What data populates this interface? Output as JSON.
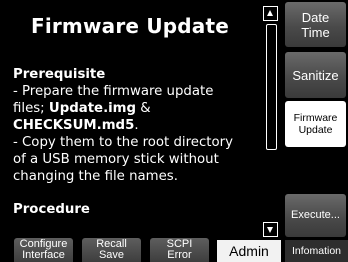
{
  "title": "Firmware Update",
  "content": {
    "prerequisite_heading": "Prerequisite",
    "line_1": "- Prepare the firmware update",
    "line_2_prefix": "files; ",
    "file_1": "Update.img",
    "line_2_suffix": " &",
    "file_2": "CHECKSUM.md5",
    "line_3_suffix": ".",
    "line_4": "- Copy them to the root directory",
    "line_5": "of a USB memory stick without",
    "line_6": "changing the file names.",
    "procedure_heading": "Procedure"
  },
  "side_keys": {
    "date_time": "Date\nTime",
    "sanitize": "Sanitize",
    "firmware_update": "Firmware\nUpdate",
    "execute": "Execute..."
  },
  "bottom_keys": {
    "configure_interface_1": "Configure",
    "configure_interface_2": "Interface",
    "recall_save_1": "Recall",
    "recall_save_2": "Save",
    "scpi_error_1": "SCPI",
    "scpi_error_2": "Error",
    "admin": "Admin",
    "information": "Infomation"
  }
}
